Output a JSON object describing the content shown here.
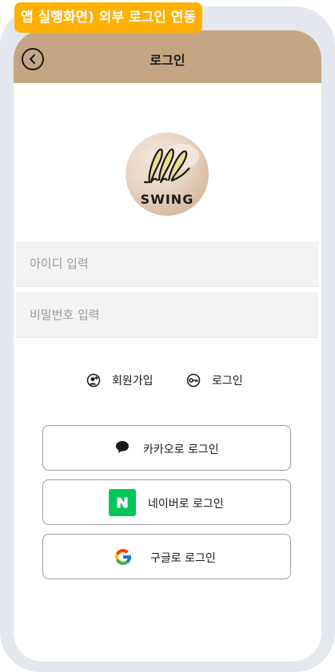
{
  "caption": "앱 실행화면) 외부 로그인 연동",
  "header": {
    "title": "로그인",
    "background_color": "#c5a684",
    "back_icon": "chevron-left-circle-icon"
  },
  "logo": {
    "text": "SWING",
    "icon": "swing-logo"
  },
  "form": {
    "id_placeholder": "아이디 입력",
    "password_placeholder": "비밀번호 입력"
  },
  "links": {
    "signup_label": "회원가입",
    "signup_icon": "user-add-icon",
    "login_label": "로그인",
    "login_icon": "key-icon"
  },
  "social": {
    "kakao_label": "카카오로 로그인",
    "kakao_icon": "chat-bubble-icon",
    "naver_label": "네이버로 로그인",
    "naver_icon": "naver-n-icon",
    "naver_color": "#03c75a",
    "google_label": "구글로 로그인",
    "google_icon": "google-g-icon"
  },
  "accent_color": "#ffb000"
}
